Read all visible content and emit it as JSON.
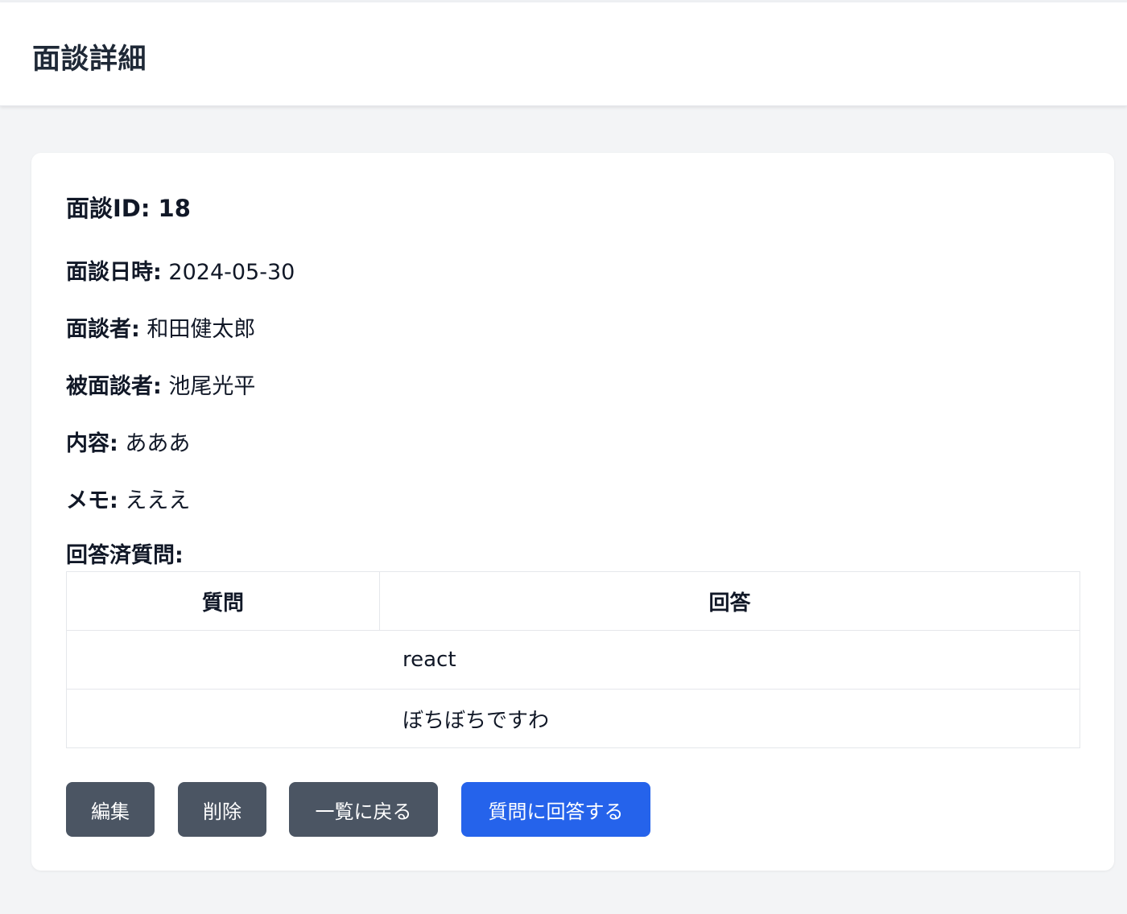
{
  "header": {
    "title": "面談詳細"
  },
  "interview": {
    "id_label": "面談ID: 18",
    "date_label": "面談日時",
    "date_value": "2024-05-30",
    "interviewer_label": "面談者",
    "interviewer_value": "和田健太郎",
    "interviewee_label": "被面談者",
    "interviewee_value": "池尾光平",
    "content_label": "内容",
    "content_value": "あああ",
    "memo_label": "メモ",
    "memo_value": "えええ"
  },
  "answered": {
    "title": "回答済質問:",
    "columns": [
      "質問",
      "回答"
    ],
    "rows": [
      {
        "question": "",
        "answer": "react"
      },
      {
        "question": "",
        "answer": "ぼちぼちですわ"
      }
    ]
  },
  "buttons": {
    "edit": "編集",
    "delete": "削除",
    "back": "一覧に戻る",
    "answer": "質問に回答する"
  },
  "colors": {
    "primary": "#2563eb",
    "secondary": "#4b5563"
  }
}
